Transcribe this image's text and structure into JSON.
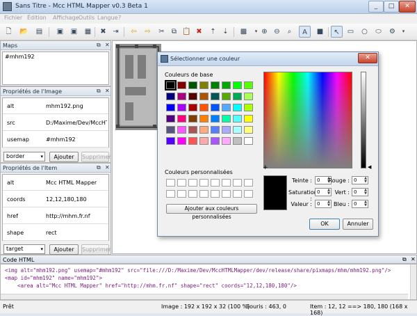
{
  "window": {
    "title": "Sans Titre - Mcc HTML Mapper v0.3 Beta 1"
  },
  "menu": [
    "Fichier",
    "Édition",
    "Affichage",
    "Outils",
    "Langue",
    "?"
  ],
  "maps_panel": {
    "title": "Maps",
    "items": [
      "#mhm192"
    ]
  },
  "image_props": {
    "title": "Propriétés de l'Image",
    "rows": [
      {
        "key": "alt",
        "value": "mhm192.png"
      },
      {
        "key": "src",
        "value": "D:/Maxime/Dev/MccHTM..."
      },
      {
        "key": "usemap",
        "value": "#mhm192"
      }
    ],
    "combo": "border",
    "add": "Ajouter",
    "remove": "Supprimer"
  },
  "item_props": {
    "title": "Propriétés de l'Item",
    "rows": [
      {
        "key": "alt",
        "value": "Mcc HTML Mapper"
      },
      {
        "key": "coords",
        "value": "12,12,180,180"
      },
      {
        "key": "href",
        "value": "http://mhm.fr.nf"
      },
      {
        "key": "shape",
        "value": "rect"
      }
    ],
    "combo": "target",
    "add": "Ajouter",
    "remove": "Supprimer"
  },
  "dialog": {
    "title": "Sélectionner une couleur",
    "basic_label": "Couleurs de base",
    "custom_label": "Couleurs personnalisées",
    "add_custom": "Ajouter aux couleurs personnalisées",
    "fields": {
      "hue": {
        "label": "Teinte :",
        "value": "0"
      },
      "sat": {
        "label": "Saturation :",
        "value": "0"
      },
      "val": {
        "label": "Valeur :",
        "value": "0"
      },
      "red": {
        "label": "Rouge :",
        "value": "0"
      },
      "green": {
        "label": "Vert :",
        "value": "0"
      },
      "blue": {
        "label": "Bleu :",
        "value": "0"
      }
    },
    "ok": "OK",
    "cancel": "Annuler",
    "basic_colors": [
      "#000000",
      "#800000",
      "#005500",
      "#808000",
      "#008000",
      "#00aa00",
      "#00ff00",
      "#55ff00",
      "#00007f",
      "#aa007f",
      "#550000",
      "#aa5500",
      "#005555",
      "#55aa00",
      "#00aa55",
      "#aaff55",
      "#0000ff",
      "#aa00ff",
      "#aa0000",
      "#ff5500",
      "#0055ff",
      "#55aaff",
      "#00ffff",
      "#aaff00",
      "#55007f",
      "#ff007f",
      "#7f3f00",
      "#ff7f00",
      "#0080ff",
      "#00ffaa",
      "#55ffff",
      "#ffff00",
      "#55557f",
      "#ff55ff",
      "#aa5555",
      "#ffaa7f",
      "#557fff",
      "#aaaaff",
      "#aaffff",
      "#ffff7f",
      "#5500ff",
      "#ff00ff",
      "#ff5555",
      "#ffaaaa",
      "#aa55ff",
      "#ffaaff",
      "#c0c0c0",
      "#ffffff"
    ]
  },
  "code_panel": {
    "title": "Code HTML",
    "lines": [
      "<img alt=\"mhm192.png\" usemap=\"#mhm192\" src=\"file:///D:/Maxime/Dev/MccHTMLMapper/dev/release/share/pixmaps/mhm/mhm192.png\"/>",
      "<map id=\"mhm192\" name=\"mhm192\">",
      "    <area alt=\"Mcc HTML Mapper\" href=\"http://mhm.fr.nf\" shape=\"rect\" coords=\"12,12,180,180\"/>"
    ]
  },
  "status": {
    "ready": "Prêt",
    "image": "Image : 192 x 192 x 32 (100 %)",
    "mouse": "Souris : 463, 0",
    "item": "Item : 12, 12 ==> 180, 180 (168 x 168)"
  }
}
